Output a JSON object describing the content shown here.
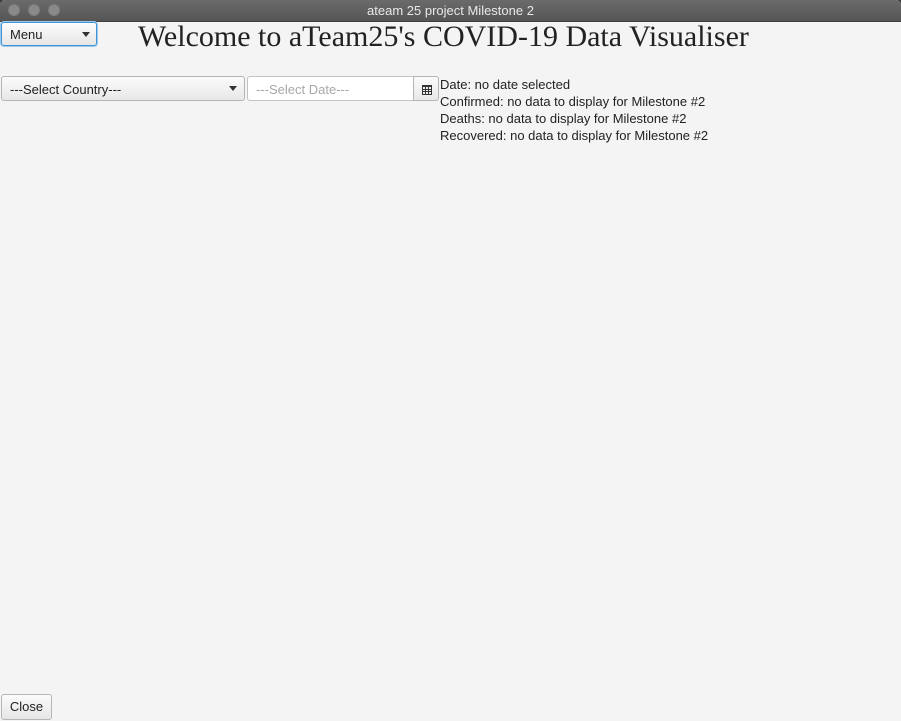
{
  "window": {
    "title": "ateam 25 project Milestone 2"
  },
  "menu": {
    "label": "Menu"
  },
  "heading": "Welcome to aTeam25's COVID-19 Data Visualiser",
  "country_select": {
    "selected": "---Select Country---"
  },
  "date_picker": {
    "placeholder": "---Select Date---",
    "icon": "calendar-icon"
  },
  "info": {
    "date": "Date: no date selected",
    "confirmed": "Confirmed: no data to display for Milestone #2",
    "deaths": "Deaths: no data to display for Milestone #2",
    "recovered": "Recovered: no data to display for Milestone #2"
  },
  "footer": {
    "close_label": "Close"
  },
  "colors": {
    "focus_accent": "#3d95d8",
    "background": "#f4f4f4"
  }
}
